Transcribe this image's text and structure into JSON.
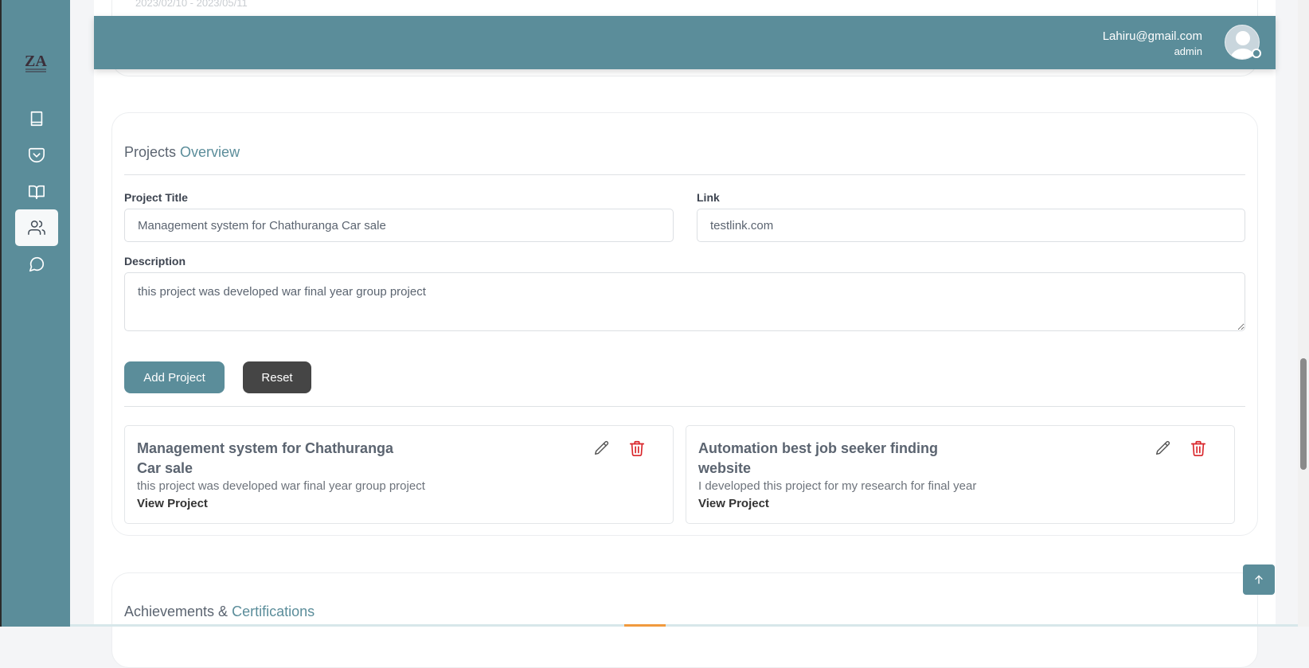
{
  "sidebar": {
    "logo_text": "ZA",
    "items": [
      {
        "name": "courses",
        "icon": "book-icon"
      },
      {
        "name": "pocket",
        "icon": "pocket-icon"
      },
      {
        "name": "library",
        "icon": "open-book-icon"
      },
      {
        "name": "users",
        "icon": "users-icon",
        "active": true
      },
      {
        "name": "messages",
        "icon": "message-circle-icon"
      }
    ]
  },
  "header": {
    "email": "Lahiru@gmail.com",
    "role": "admin"
  },
  "previous_section": {
    "faded_text": "2023/02/10 - 2023/05/11"
  },
  "projects": {
    "title_prefix": "Projects",
    "title_accent": "Overview",
    "form": {
      "title_label": "Project Title",
      "title_value": "Management system for Chathuranga Car sale",
      "link_label": "Link",
      "link_value": "testlink.com",
      "description_label": "Description",
      "description_value": "this project was developed war final year group project"
    },
    "buttons": {
      "add": "Add Project",
      "reset": "Reset"
    },
    "list": [
      {
        "title": "Management system for Chathuranga Car sale",
        "description": "this project was developed war final year group project",
        "link_label": "View Project"
      },
      {
        "title": "Automation best job seeker finding website",
        "description": "I developed this project for my research for final year",
        "link_label": "View Project"
      }
    ]
  },
  "achievements": {
    "title_prefix": "Achievements &",
    "title_accent": "Certifications"
  },
  "colors": {
    "primary": "#5b8d9a",
    "dark_button": "#454545",
    "delete_red": "#d9262b"
  }
}
